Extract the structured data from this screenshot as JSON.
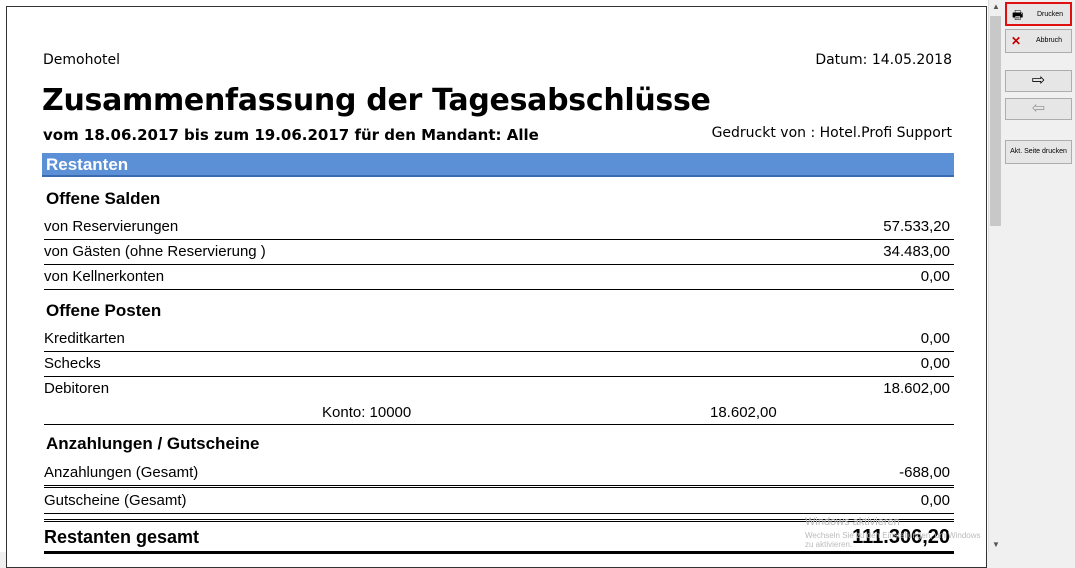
{
  "report": {
    "hotel": "Demohotel",
    "date": "Datum: 14.05.2018",
    "title": "Zusammenfassung der Tagesabschlüsse",
    "subtitle": "vom 18.06.2017 bis zum 19.06.2017 für den Mandant: Alle",
    "printed_by": "Gedruckt von : Hotel.Profi Support",
    "section": "Restanten",
    "offene_salden": {
      "title": "Offene Salden",
      "rows": [
        {
          "label": "von Reservierungen",
          "value": "57.533,20"
        },
        {
          "label": "von Gästen (ohne Reservierung )",
          "value": "34.483,00"
        },
        {
          "label": "von Kellnerkonten",
          "value": "0,00"
        }
      ]
    },
    "offene_posten": {
      "title": "Offene Posten",
      "rows": [
        {
          "label": "Kreditkarten",
          "value": "0,00"
        },
        {
          "label": "Schecks",
          "value": "0,00"
        },
        {
          "label": "Debitoren",
          "value": "18.602,00"
        }
      ],
      "sub": {
        "label": "Konto: 10000",
        "value": "18.602,00"
      }
    },
    "anzahlungen": {
      "title": "Anzahlungen / Gutscheine",
      "rows": [
        {
          "label": "Anzahlungen (Gesamt)",
          "value": "-688,00"
        },
        {
          "label": "Gutscheine (Gesamt)",
          "value": "0,00"
        }
      ]
    },
    "total": {
      "label": "Restanten gesamt",
      "value": "111.306,20"
    }
  },
  "panel": {
    "print_label": "Drucken",
    "cancel_label": "Abbruch",
    "next_symbol": "⇨",
    "prev_symbol": "⇦",
    "print_page_label": "Akt. Seite drucken"
  },
  "watermark": {
    "line1": "Windows aktivieren",
    "line2": "Wechseln Sie zu den Einstellungen, um Windows zu aktivieren."
  }
}
